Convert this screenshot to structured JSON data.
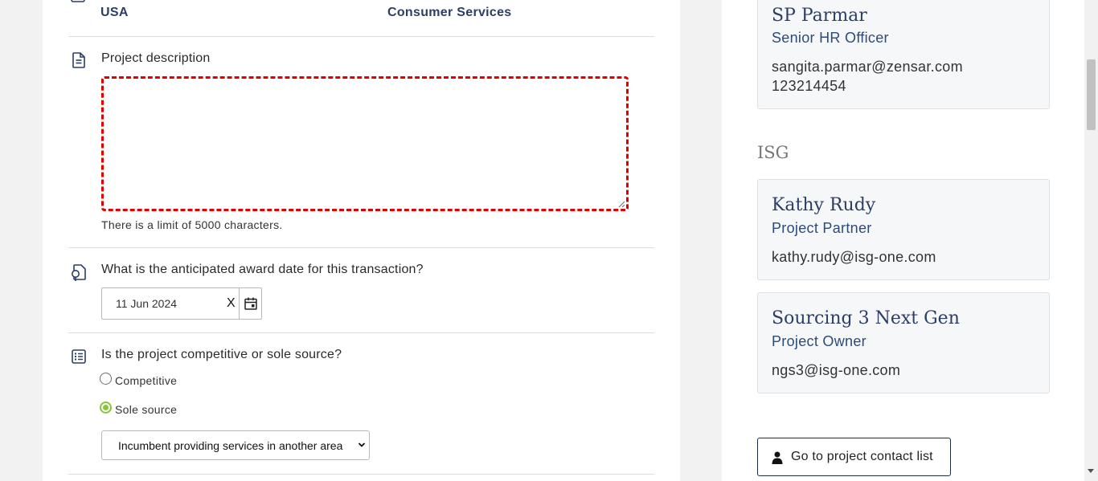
{
  "location": {
    "country": "USA",
    "industry": "Consumer Services"
  },
  "project_description": {
    "label": "Project description",
    "value": "",
    "hint": "There is a limit of 5000 characters."
  },
  "award_date": {
    "label": "What is the anticipated award date for this transaction?",
    "value": "11 Jun 2024",
    "clear_label": "X"
  },
  "competitive": {
    "label": "Is the project competitive or sole source?",
    "options": [
      {
        "label": "Competitive",
        "checked": false
      },
      {
        "label": "Sole source",
        "checked": true
      }
    ],
    "reason_select": {
      "value": "Incumbent providing services in another area"
    }
  },
  "contacts": {
    "client_contact": {
      "name": "SP Parmar",
      "role": "Senior HR Officer",
      "email": "sangita.parmar@zensar.com",
      "phone": "123214454"
    },
    "isg_title": "ISG",
    "isg": [
      {
        "name": "Kathy Rudy",
        "role": "Project Partner",
        "email": "kathy.rudy@isg-one.com"
      },
      {
        "name": "Sourcing 3 Next Gen",
        "role": "Project Owner",
        "email": "ngs3@isg-one.com"
      }
    ],
    "contact_list_button": "Go to project contact list"
  },
  "colors": {
    "accent_navy": "#2c3e66",
    "dashed_highlight": "#e00000",
    "radio_checked": "#8ac43f"
  },
  "icons": [
    "document-icon",
    "calendar-date-icon",
    "list-icon",
    "calendar-icon",
    "person-icon"
  ]
}
